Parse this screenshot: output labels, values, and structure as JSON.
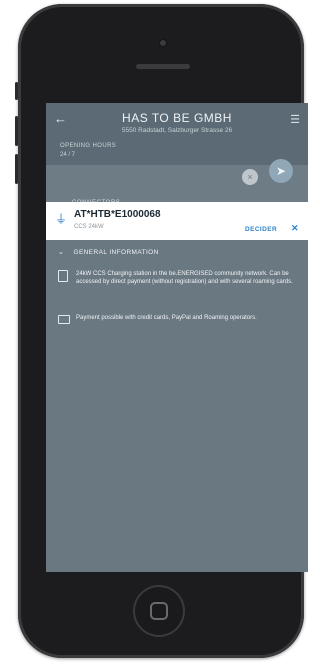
{
  "appbar": {
    "title": "HAS TO BE GMBH",
    "subtitle": "5550 Radstadt, Salzburger Strasse 26",
    "hours_label": "OPENING HOURS",
    "hours_value": "24 / 7"
  },
  "sections": {
    "connectors_label": "CONNECTORS"
  },
  "connector": {
    "id": "AT*HTB*E1000068",
    "type": "CCS 24kW",
    "action_label": "DECIDER",
    "close_icon": "close-icon"
  },
  "general": {
    "header": "GENERAL INFORMATION",
    "items": [
      {
        "icon": "document-icon",
        "text": "24kW CCS Charging station in the be.ENERGISED community network. Can be accessed by direct payment (without registration) and with several roaming cards."
      },
      {
        "icon": "credit-card-icon",
        "text": "Payment possible with credit cards, PayPal and Roaming operators."
      }
    ]
  },
  "colors": {
    "accent": "#2f83c9",
    "overlay": "#6e7c86",
    "phone_body": "#1c1c1e"
  }
}
